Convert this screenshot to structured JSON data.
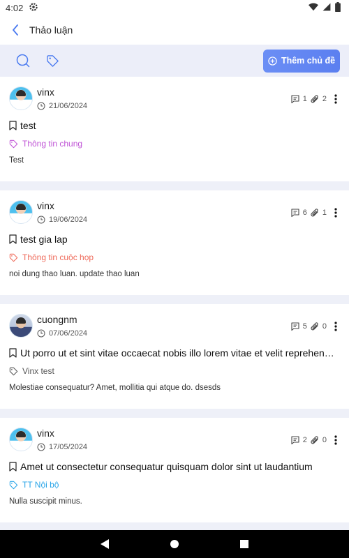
{
  "status_bar": {
    "time": "4:02"
  },
  "app_bar": {
    "title": "Thảo luận"
  },
  "toolbar": {
    "add_topic_label": "Thêm chủ đề"
  },
  "topics": [
    {
      "author": "vinx",
      "date": "21/06/2024",
      "comments": "1",
      "attachments": "2",
      "title": "test",
      "tag": "Thông tin chung",
      "tag_color": "#c055d6",
      "description": "Test",
      "avatar": "photo"
    },
    {
      "author": "vinx",
      "date": "19/06/2024",
      "comments": "6",
      "attachments": "1",
      "title": "test gia lap",
      "tag": "Thông tin cuộc họp",
      "tag_color": "#ef6b5b",
      "description": "noi dung thao luan. update thao luan",
      "avatar": "photo"
    },
    {
      "author": "cuongnm",
      "date": "07/06/2024",
      "comments": "5",
      "attachments": "0",
      "title": "Ut porro ut et sint vitae occaecat nobis illo lorem vitae et velit reprehenderit",
      "tag": "Vinx test",
      "tag_color": "#555555",
      "description": "Molestiae consequatur? Amet, mollitia qui atque do. dsesds",
      "avatar": "photo-alt"
    },
    {
      "author": "vinx",
      "date": "17/05/2024",
      "comments": "2",
      "attachments": "0",
      "title": "Amet ut consectetur consequatur quisquam dolor sint ut laudantium",
      "tag": "TT Nội bộ",
      "tag_color": "#2aa5e8",
      "description": "Nulla suscipit minus.",
      "avatar": "photo"
    }
  ]
}
